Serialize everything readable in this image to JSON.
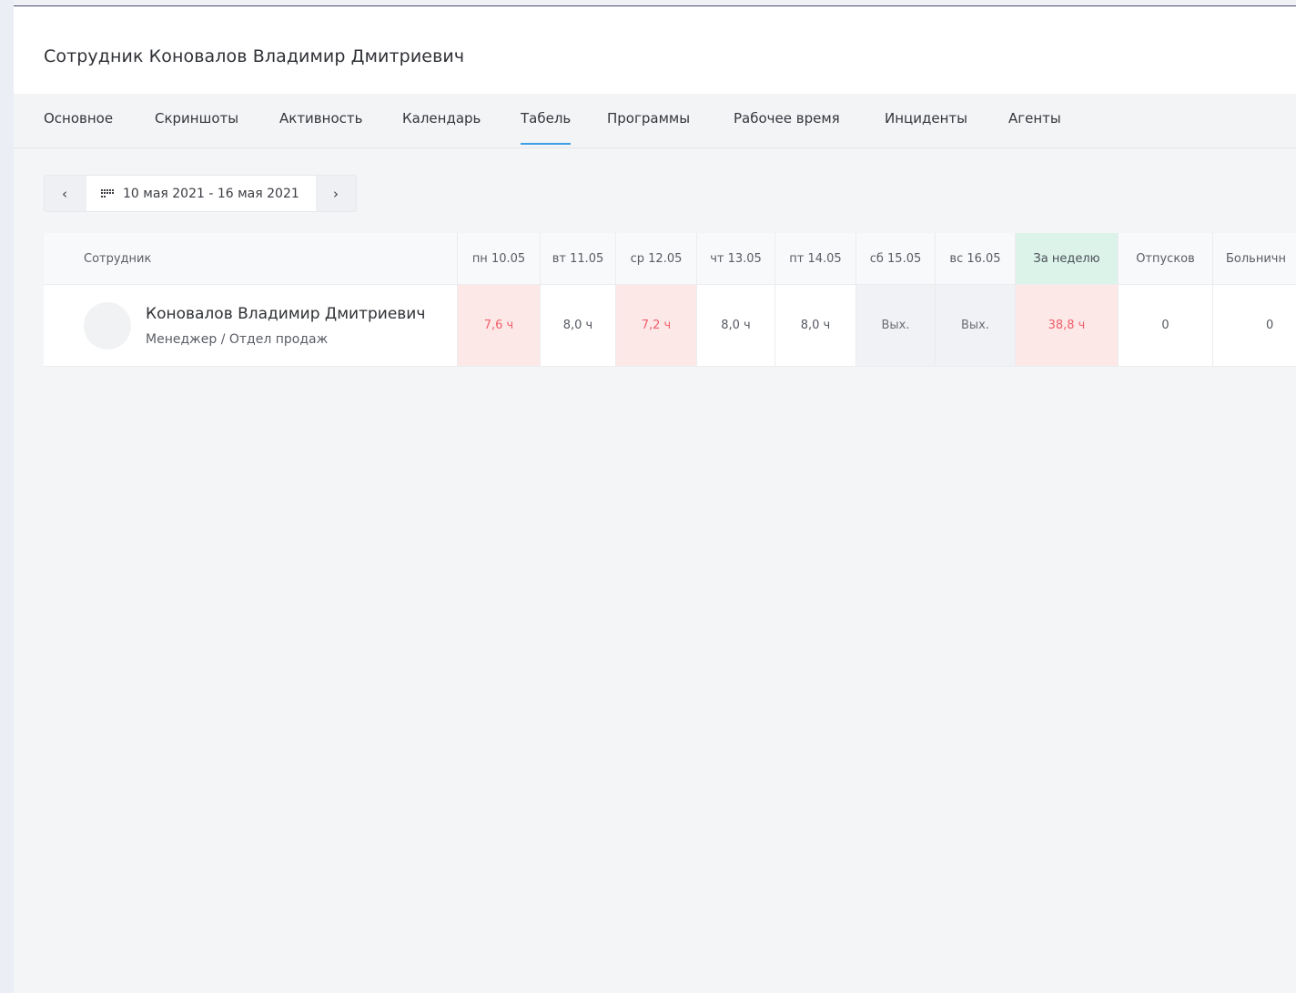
{
  "title": "Сотрудник Коновалов Владимир Дмитриевич",
  "tabs": [
    {
      "label": "Основное"
    },
    {
      "label": "Скриншоты"
    },
    {
      "label": "Активность"
    },
    {
      "label": "Календарь"
    },
    {
      "label": "Табель",
      "active": true
    },
    {
      "label": "Программы"
    },
    {
      "label": "Рабочее время"
    },
    {
      "label": "Инциденты"
    },
    {
      "label": "Агенты"
    }
  ],
  "period": {
    "prev": "‹",
    "range": "10 мая 2021 - 16 мая 2021",
    "next": "›",
    "icon": "calendar-icon"
  },
  "table": {
    "headers": [
      "Сотрудник",
      "пн 10.05",
      "вт 11.05",
      "ср 12.05",
      "чт 13.05",
      "пт 14.05",
      "сб 15.05",
      "вс 16.05",
      "За неделю",
      "Отпусков",
      "Больничн"
    ],
    "rows": [
      {
        "name": "Коновалов Владимир Дмитриевич",
        "role": "Менеджер / Отдел продаж",
        "cells": [
          "7,6 ч",
          "8,0 ч",
          "7,2 ч",
          "8,0 ч",
          "8,0 ч",
          "Вых.",
          "Вых.",
          "38,8 ч",
          "0",
          "0"
        ]
      }
    ]
  },
  "colors": {
    "accent": "#3c9fe8",
    "shortfall_bg": "#fde8e8",
    "shortfall_text": "#f0606b",
    "week_header_bg": "#dcf3ea",
    "weekend_bg": "#f1f2f5"
  }
}
